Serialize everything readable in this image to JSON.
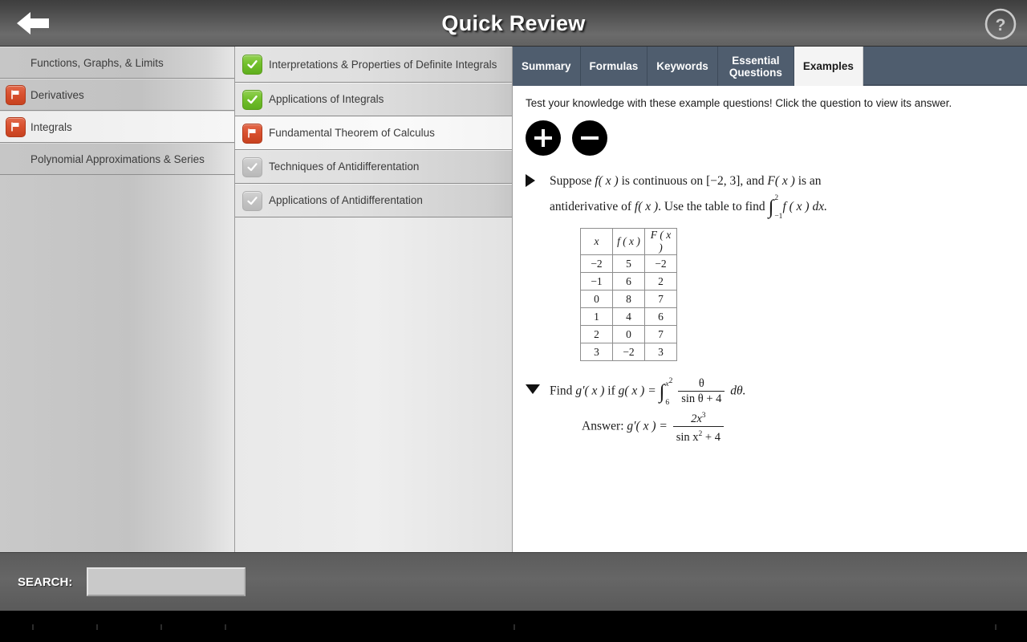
{
  "header": {
    "title": "Quick Review",
    "back_icon": "back-arrow-icon",
    "help_icon": "question-mark-icon"
  },
  "sidebar": {
    "items": [
      {
        "label": "Functions, Graphs, & Limits",
        "status": "none",
        "selected": false
      },
      {
        "label": "Derivatives",
        "status": "flag",
        "selected": false
      },
      {
        "label": "Integrals",
        "status": "flag",
        "selected": true
      },
      {
        "label": "Polynomial Approximations & Series",
        "status": "none",
        "selected": false
      }
    ]
  },
  "topics": {
    "items": [
      {
        "label": "Interpretations & Properties of Definite Integrals",
        "status": "check-green",
        "selected": false
      },
      {
        "label": "Applications of Integrals",
        "status": "check-green",
        "selected": false
      },
      {
        "label": "Fundamental Theorem of Calculus",
        "status": "flag",
        "selected": true
      },
      {
        "label": "Techniques of Antidifferentation",
        "status": "check-gray",
        "selected": false
      },
      {
        "label": "Applications of Antidifferentation",
        "status": "check-gray",
        "selected": false
      }
    ]
  },
  "tabs": {
    "items": [
      {
        "label": "Summary",
        "active": false
      },
      {
        "label": "Formulas",
        "active": false
      },
      {
        "label": "Keywords",
        "active": false
      },
      {
        "label": "Essential Questions",
        "active": true,
        "two_line": true
      },
      {
        "label": "Examples",
        "active": true
      }
    ],
    "active_label": "Examples"
  },
  "content": {
    "intro": "Test your knowledge with these example questions! Click the question to view its answer.",
    "expand_all_label": "+",
    "collapse_all_label": "−",
    "questions": [
      {
        "marker": "collapsed",
        "line1_a": "Suppose",
        "line1_f": "f",
        "line1_b": "( x )",
        "line1_c": "is continuous on",
        "line1_interval": "[−2, 3]",
        "line1_d": ", and",
        "line1_F": "F",
        "line1_e": "( x )",
        "line1_g": "is an",
        "line2_a": "antiderivative of",
        "line2_f": "f",
        "line2_b": "( x )",
        "line2_c": ". Use the table to find",
        "integral_upper": "2",
        "integral_lower": "−1",
        "integral_body": "f ( x ) dx."
      },
      {
        "marker": "expanded",
        "prompt_a": "Find",
        "prompt_g": "g′( x )",
        "prompt_b": "if",
        "prompt_g2": "g( x ) =",
        "integral_upper": "x",
        "integral_upper_sup": "2",
        "integral_lower": "6",
        "frac_num": "θ",
        "frac_den_a": "sin θ + 4",
        "differential": "dθ.",
        "answer_label": "Answer:",
        "answer_g": "g′( x ) =",
        "answer_num": "2x",
        "answer_num_sup": "3",
        "answer_den_a": "sin x",
        "answer_den_sup": "2",
        "answer_den_b": "+ 4"
      }
    ],
    "table": {
      "headers": [
        "x",
        "f ( x )",
        "F ( x )"
      ],
      "rows": [
        [
          "−2",
          "5",
          "−2"
        ],
        [
          "−1",
          "6",
          "2"
        ],
        [
          "0",
          "8",
          "7"
        ],
        [
          "1",
          "4",
          "6"
        ],
        [
          "2",
          "0",
          "7"
        ],
        [
          "3",
          "−2",
          "3"
        ]
      ]
    }
  },
  "search": {
    "label": "SEARCH:",
    "value": "",
    "placeholder": ""
  },
  "colors": {
    "tabbar": "#4f5d6e",
    "flag_badge": "#d9512f",
    "check_badge": "#72c02c",
    "header_gray": "#5a5a5a"
  }
}
